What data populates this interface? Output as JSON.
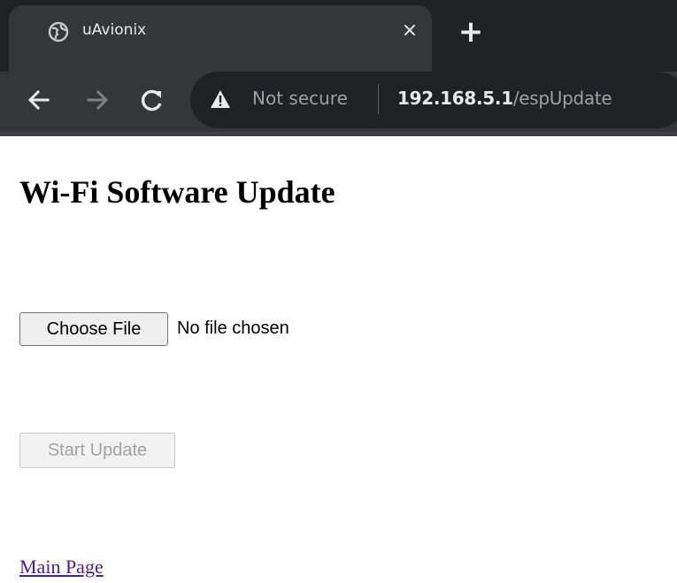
{
  "browser": {
    "tab": {
      "title": "uAvionix",
      "favicon": "globe-icon",
      "close_glyph": "×"
    },
    "new_tab_glyph": "+",
    "nav": {
      "back": "←",
      "forward": "→",
      "reload": "C"
    },
    "address_bar": {
      "security_label": "Not secure",
      "security_icon": "warning-icon",
      "url_host": "192.168.5.1",
      "url_path": "/espUpdate"
    }
  },
  "page": {
    "title": "Wi-Fi Software Update",
    "file_input": {
      "button_label": "Choose File",
      "status_text": "No file chosen"
    },
    "start_update_label": "Start Update",
    "main_page_link": "Main Page"
  },
  "colors": {
    "chrome_dark": "#202124",
    "chrome_toolbar": "#35363a",
    "visited_link": "#551a8b"
  }
}
